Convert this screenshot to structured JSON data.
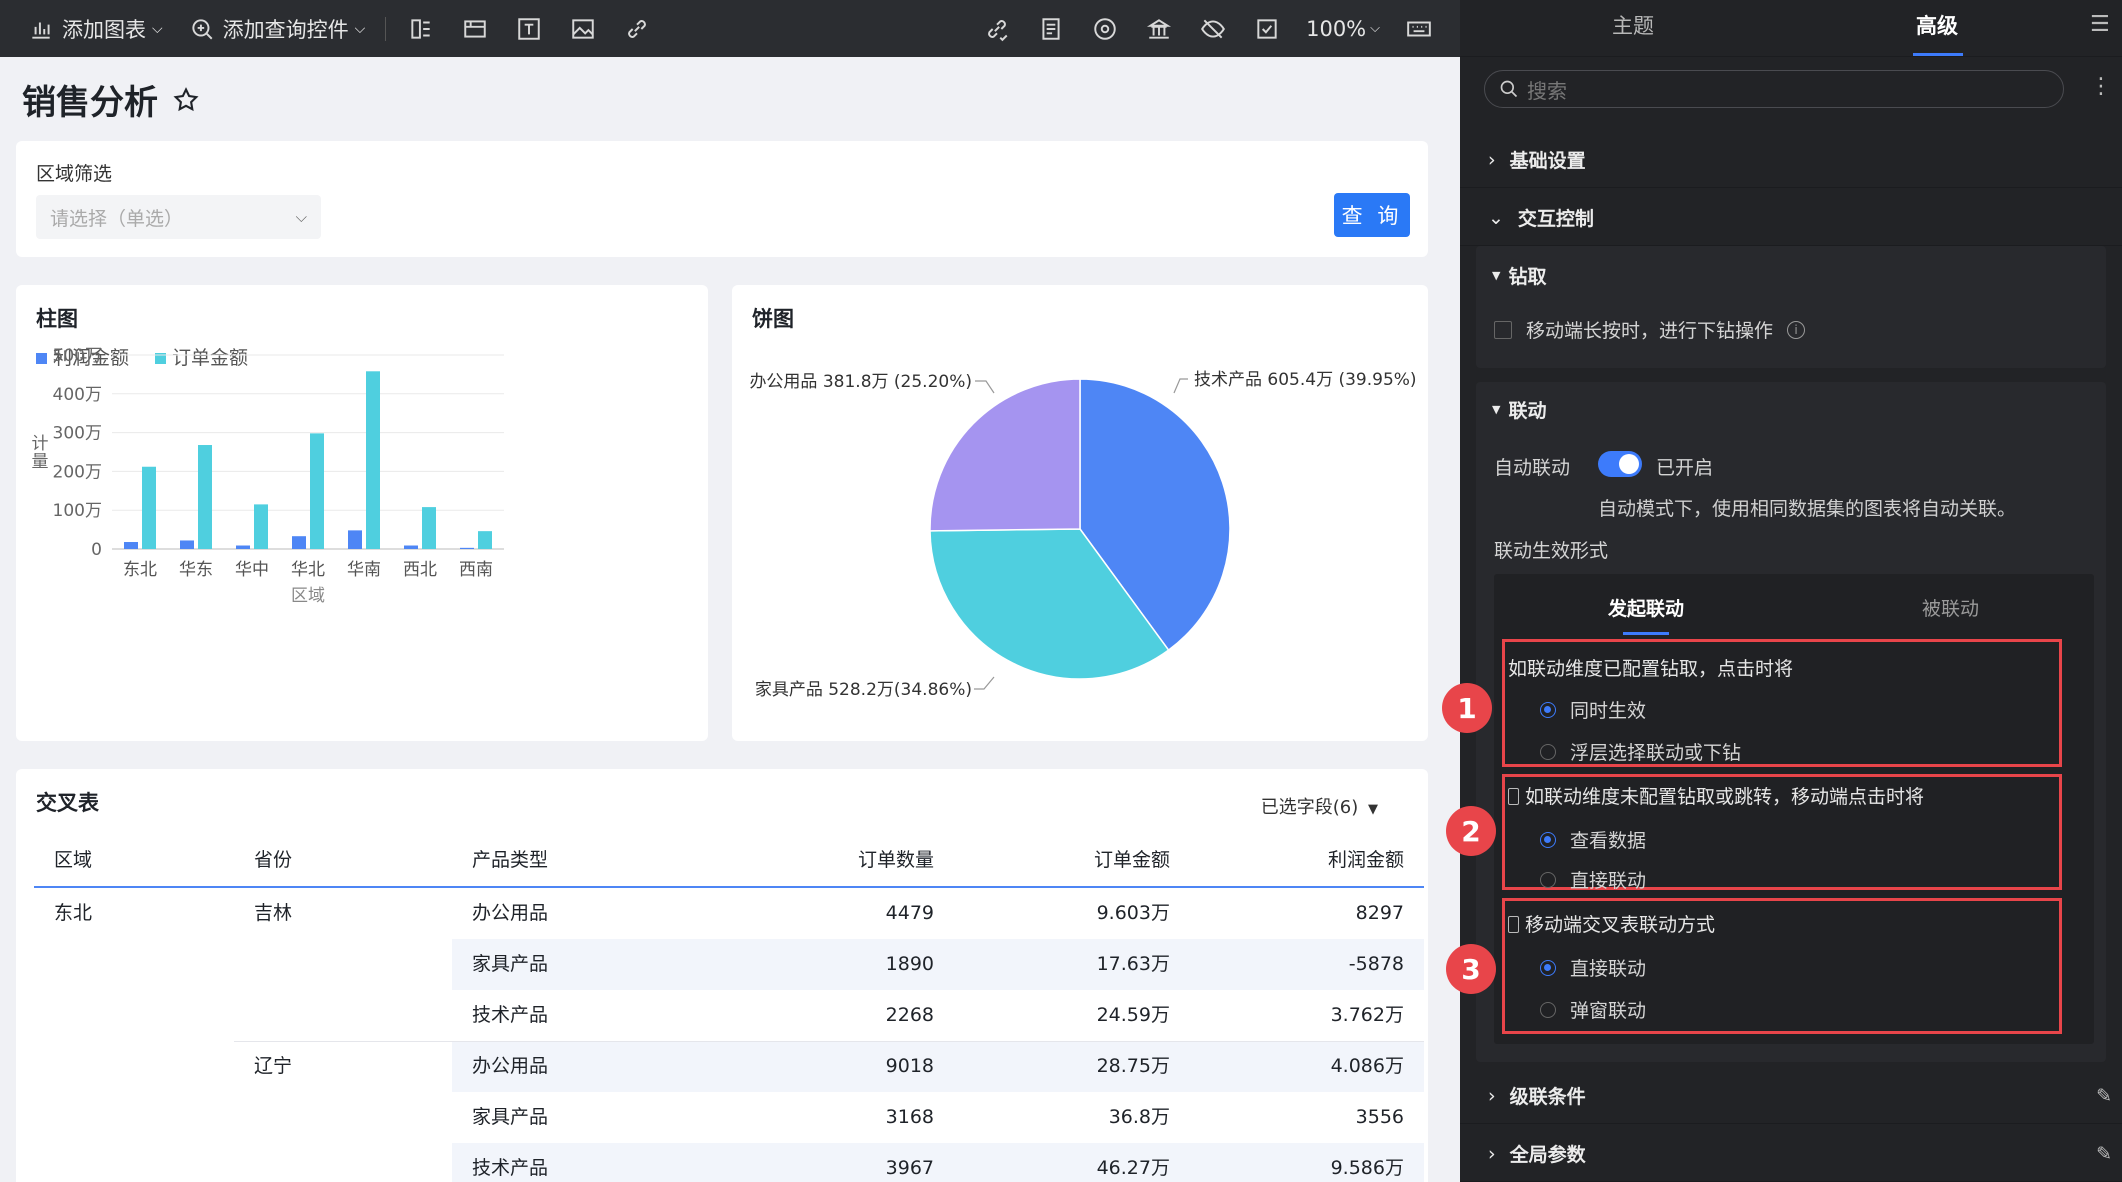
{
  "toolbar": {
    "add_chart": "添加图表",
    "add_query": "添加查询控件",
    "zoom": "100%"
  },
  "page": {
    "title": "销售分析"
  },
  "filter": {
    "label": "区域筛选",
    "placeholder": "请选择（单选）",
    "query_button": "查 询"
  },
  "bar_card": {
    "title": "柱图",
    "legend": [
      "利润金额",
      "订单金额"
    ]
  },
  "pie_card": {
    "title": "饼图",
    "labels": [
      "办公用品 381.8万 (25.20%)",
      "技术产品 605.4万 (39.95%)",
      "家具产品 528.2万(34.86%)"
    ]
  },
  "chart_data": [
    {
      "type": "bar",
      "title": "柱图",
      "xlabel": "区域",
      "ylabel": "计量",
      "categories": [
        "东北",
        "华东",
        "华中",
        "华北",
        "华南",
        "西北",
        "西南"
      ],
      "yticks": [
        "500万",
        "400万",
        "300万",
        "200万",
        "100万",
        "0"
      ],
      "ylim": [
        0,
        500
      ],
      "series": [
        {
          "name": "利润金额",
          "color": "#4e86f5",
          "values": [
            18,
            22,
            9,
            33,
            48,
            9,
            3
          ]
        },
        {
          "name": "订单金额",
          "color": "#4fcfdf",
          "values": [
            212,
            268,
            115,
            298,
            458,
            108,
            46
          ]
        }
      ]
    },
    {
      "type": "pie",
      "title": "饼图",
      "slices": [
        {
          "name": "技术产品",
          "value": 605.4,
          "pct": 39.95,
          "color": "#4e86f5"
        },
        {
          "name": "家具产品",
          "value": 528.2,
          "pct": 34.86,
          "color": "#4fcfdf"
        },
        {
          "name": "办公用品",
          "value": 381.8,
          "pct": 25.2,
          "color": "#a594f0"
        }
      ]
    }
  ],
  "cross_table": {
    "title": "交叉表",
    "selected_fields": "已选字段(6)",
    "headers": [
      "区域",
      "省份",
      "产品类型",
      "订单数量",
      "订单金额",
      "利润金额"
    ],
    "rows": [
      {
        "region": "东北",
        "province": "吉林",
        "type": "办公用品",
        "qty": "4479",
        "amount": "9.603万",
        "profit": "8297"
      },
      {
        "region": "",
        "province": "",
        "type": "家具产品",
        "qty": "1890",
        "amount": "17.63万",
        "profit": "-5878"
      },
      {
        "region": "",
        "province": "",
        "type": "技术产品",
        "qty": "2268",
        "amount": "24.59万",
        "profit": "3.762万"
      },
      {
        "region": "",
        "province": "辽宁",
        "type": "办公用品",
        "qty": "9018",
        "amount": "28.75万",
        "profit": "4.086万"
      },
      {
        "region": "",
        "province": "",
        "type": "家具产品",
        "qty": "3168",
        "amount": "36.8万",
        "profit": "3556"
      },
      {
        "region": "",
        "province": "",
        "type": "技术产品",
        "qty": "3967",
        "amount": "46.27万",
        "profit": "9.586万"
      }
    ]
  },
  "panel": {
    "tabs": [
      "主题",
      "高级"
    ],
    "search_placeholder": "搜索",
    "sections": {
      "basic": "基础设置",
      "interaction": "交互控制",
      "cascade": "级联条件",
      "global_params": "全局参数"
    },
    "drill": {
      "title": "钻取",
      "mobile_option": "移动端长按时，进行下钻操作"
    },
    "linkage": {
      "title": "联动",
      "auto_label": "自动联动",
      "auto_state": "已开启",
      "auto_desc": "自动模式下，使用相同数据集的图表将自动关联。",
      "mode_label": "联动生效形式",
      "tabs": [
        "发起联动",
        "被联动"
      ],
      "group1_title": "如联动维度已配置钻取，点击时将",
      "group1_options": [
        "同时生效",
        "浮层选择联动或下钻"
      ],
      "group2_title": "如联动维度未配置钻取或跳转，移动端点击时将",
      "group2_options": [
        "查看数据",
        "直接联动"
      ],
      "group3_title": "移动端交叉表联动方式",
      "group3_options": [
        "直接联动",
        "弹窗联动"
      ]
    },
    "badges": [
      "1",
      "2",
      "3"
    ]
  }
}
